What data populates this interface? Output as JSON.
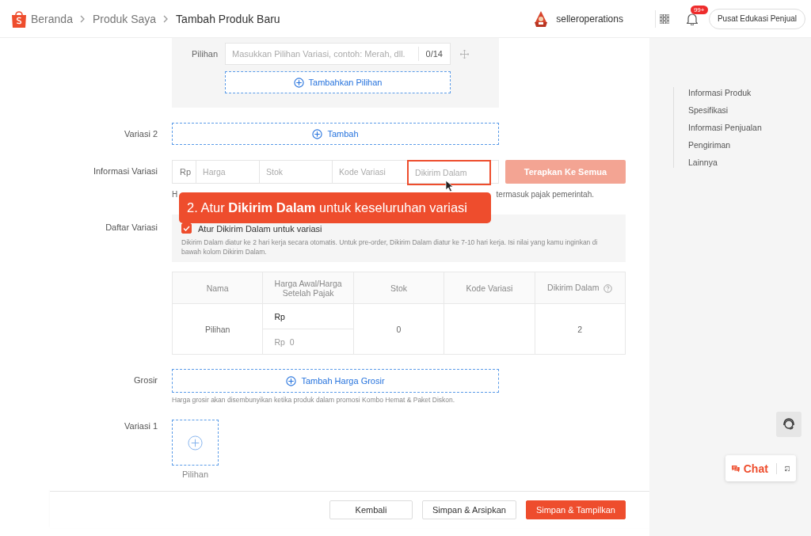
{
  "breadcrumbs": [
    {
      "label": "Beranda",
      "current": false
    },
    {
      "label": "Produk Saya",
      "current": false
    },
    {
      "label": "Tambah Produk Baru",
      "current": true
    }
  ],
  "header": {
    "username": "selleroperations",
    "notification_badge": "99+",
    "help_button": "Pusat Edukasi Penjual"
  },
  "option_group": {
    "label": "Pilihan",
    "placeholder": "Masukkan Pilihan Variasi, contoh: Merah, dll.",
    "counter": "0/14",
    "add_button": "Tambahkan Pilihan"
  },
  "variation_2": {
    "label": "Variasi 2",
    "button": "Tambah"
  },
  "variation_info": {
    "label": "Informasi Variasi",
    "currency": "Rp",
    "fields": [
      {
        "placeholder": "Harga",
        "highlighted": false
      },
      {
        "placeholder": "Stok",
        "highlighted": false
      },
      {
        "placeholder": "Kode Variasi",
        "highlighted": false
      },
      {
        "placeholder": "Dikirim Dalam",
        "highlighted": true
      }
    ],
    "apply_button": "Terapkan Ke Semua",
    "apply_disabled": true,
    "hint_start": "H",
    "hint_end": "termasuk pajak pemerintah."
  },
  "tooltip": {
    "text": "2. Atur **Dikirim Dalam** untuk keseluruhan variasi"
  },
  "variation_list": {
    "label": "Daftar Variasi",
    "checkbox": {
      "label": "Atur Dikirim Dalam untuk variasi",
      "checked": true
    },
    "note": "Dikirim Dalam diatur ke 2 hari kerja secara otomatis. Untuk pre-order, Dikirim Dalam diatur ke 7-10 hari kerja. Isi nilai yang kamu inginkan di bawah kolom Dikirim Dalam.",
    "table": {
      "columns": [
        "Nama",
        "Harga Awal/Harga Setelah Pajak",
        "Stok",
        "Kode Variasi",
        "Dikirim Dalam"
      ],
      "rows": [
        {
          "name": "Pilihan",
          "price": "Rp",
          "price_after_tax": "Rp  0",
          "stock": "0",
          "ship_days": "2"
        }
      ]
    }
  },
  "wholesale": {
    "label": "Grosir",
    "button": "Tambah Harga Grosir",
    "note": "Harga grosir akan disembunyikan ketika produk dalam promosi Kombo Hemat & Paket Diskon."
  },
  "variation_1": {
    "label": "Variasi 1",
    "option_caption": "Pilihan"
  },
  "footer_buttons": [
    {
      "label": "Kembali",
      "kind": "default"
    },
    {
      "label": "Simpan & Arsipkan",
      "kind": "default"
    },
    {
      "label": "Simpan & Tampilkan",
      "kind": "primary"
    }
  ],
  "side_nav": [
    "Informasi Produk",
    "Spesifikasi",
    "Informasi Penjualan",
    "Pengiriman",
    "Lainnya"
  ],
  "chat": {
    "label": "Chat"
  }
}
